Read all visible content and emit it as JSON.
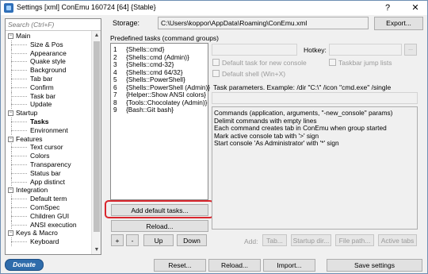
{
  "window": {
    "title": "Settings [xml] ConEmu 160724 [64] {Stable}",
    "help_glyph": "?",
    "close_glyph": "✕"
  },
  "sidebar": {
    "search_placeholder": "Search (Ctrl+F)",
    "items": [
      {
        "label": "Main",
        "level": 0,
        "expander": "−"
      },
      {
        "label": "Size & Pos",
        "level": 1
      },
      {
        "label": "Appearance",
        "level": 1
      },
      {
        "label": "Quake style",
        "level": 1
      },
      {
        "label": "Background",
        "level": 1
      },
      {
        "label": "Tab bar",
        "level": 1
      },
      {
        "label": "Confirm",
        "level": 1
      },
      {
        "label": "Task bar",
        "level": 1
      },
      {
        "label": "Update",
        "level": 1
      },
      {
        "label": "Startup",
        "level": 0,
        "expander": "−"
      },
      {
        "label": "Tasks",
        "level": 1,
        "selected": true
      },
      {
        "label": "Environment",
        "level": 1
      },
      {
        "label": "Features",
        "level": 0,
        "expander": "−"
      },
      {
        "label": "Text cursor",
        "level": 1
      },
      {
        "label": "Colors",
        "level": 1
      },
      {
        "label": "Transparency",
        "level": 1
      },
      {
        "label": "Status bar",
        "level": 1
      },
      {
        "label": "App distinct",
        "level": 1
      },
      {
        "label": "Integration",
        "level": 0,
        "expander": "−"
      },
      {
        "label": "Default term",
        "level": 1
      },
      {
        "label": "ComSpec",
        "level": 1
      },
      {
        "label": "Children GUI",
        "level": 1
      },
      {
        "label": "ANSI execution",
        "level": 1
      },
      {
        "label": "Keys & Macro",
        "level": 0,
        "expander": "−"
      },
      {
        "label": "Keyboard",
        "level": 1
      }
    ]
  },
  "storage": {
    "label": "Storage:",
    "path": "C:\\Users\\koppor\\AppData\\Roaming\\ConEmu.xml",
    "export_label": "Export..."
  },
  "tasks": {
    "group_label": "Predefined tasks (command groups)",
    "items": [
      {
        "num": "1",
        "name": "{Shells::cmd}"
      },
      {
        "num": "2",
        "name": "{Shells::cmd (Admin)}"
      },
      {
        "num": "3",
        "name": "{Shells::cmd-32}"
      },
      {
        "num": "4",
        "name": "{Shells::cmd 64/32}"
      },
      {
        "num": "5",
        "name": "{Shells::PowerShell}"
      },
      {
        "num": "6",
        "name": "{Shells::PowerShell (Admin)}"
      },
      {
        "num": "7",
        "name": "{Helper::Show ANSI colors}"
      },
      {
        "num": "8",
        "name": "{Tools::Chocolatey (Admin)}"
      },
      {
        "num": "9",
        "name": "{Bash::Git bash}"
      }
    ],
    "add_default_label": "Add default tasks...",
    "reload_label": "Reload...",
    "plus_label": "+",
    "minus_label": "-",
    "up_label": "Up",
    "down_label": "Down"
  },
  "task_editor": {
    "hotkey_label": "Hotkey:",
    "hotkey_button": "...",
    "default_task_label": "Default task for new console",
    "jumplist_label": "Taskbar jump lists",
    "default_shell_label": "Default shell (Win+X)",
    "params_label": "Task parameters. Example: /dir \"C:\\\" /icon \"cmd.exe\" /single",
    "commands_text": [
      "Commands (application, arguments, \"-new_console\" params)",
      "Delimit commands with empty lines",
      "Each command creates tab in ConEmu when group started",
      "Mark active console tab with '>' sign",
      "Start console 'As Administrator' with '*' sign"
    ],
    "add_label": "Add:",
    "tab_button": "Tab...",
    "startup_dir_button": "Startup dir...",
    "file_path_button": "File path...",
    "active_tabs_button": "Active tabs"
  },
  "footer": {
    "donate_label": "Donate",
    "reset_label": "Reset...",
    "reload_label": "Reload...",
    "import_label": "Import...",
    "save_label": "Save settings"
  },
  "colors": {
    "highlight_outline": "#d9262d",
    "donate_bg": "#2f6cab"
  }
}
